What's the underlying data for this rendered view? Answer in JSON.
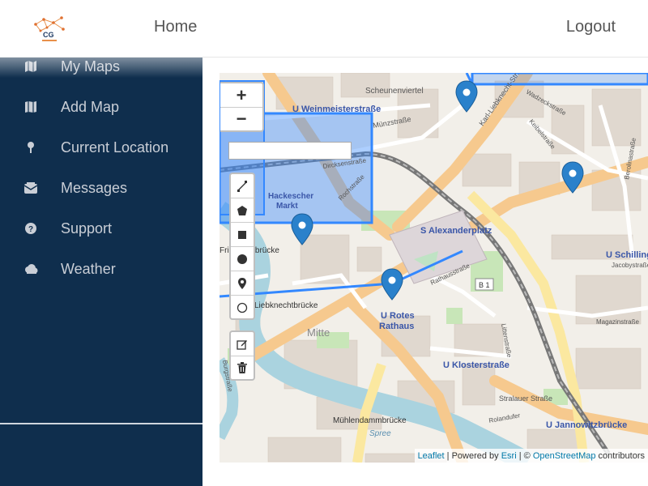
{
  "header": {
    "logo_text": "CG",
    "home_label": "Home",
    "logout_label": "Logout"
  },
  "sidebar": {
    "items": [
      {
        "label": "My Maps",
        "icon": "map-icon"
      },
      {
        "label": "Add Map",
        "icon": "map-fold-icon"
      },
      {
        "label": "Current Location",
        "icon": "pin-icon"
      },
      {
        "label": "Messages",
        "icon": "envelope-icon"
      },
      {
        "label": "Support",
        "icon": "question-circle-icon"
      },
      {
        "label": "Weather",
        "icon": "cloud-icon"
      }
    ]
  },
  "map": {
    "zoom_in": "+",
    "zoom_out": "−",
    "search_value": "",
    "draw_tools": [
      "polyline-icon",
      "polygon-icon",
      "rectangle-icon",
      "circle-icon",
      "marker-icon",
      "circle-marker-icon"
    ],
    "edit_tools": [
      "edit-icon",
      "trash-icon"
    ],
    "labels": {
      "weinmeister": "U Weinmeisterstraße",
      "scheunenviertel": "Scheunenviertel",
      "muenzstrasse": "Münzstraße",
      "karl_liebknecht": "Karl-Liebknecht-Str.",
      "hackescher_1": "Hackescher",
      "hackescher_2": "Markt",
      "alexanderplatz": "S Alexanderplatz",
      "rathausstrasse": "Rathausstraße",
      "b1": "B 1",
      "rotes_1": "U Rotes",
      "rotes_2": "Rathaus",
      "mitte": "Mitte",
      "klosterstrasse": "U Klosterstraße",
      "liebknechtbruecke": "Liebknechtbrücke",
      "friedrichsbruecke": "Friedrichsbrücke",
      "muehlendamm": "Mühlendammbrücke",
      "stralauer": "Stralauer Straße",
      "jannowitz": "U Jannowitzbrücke",
      "schilling": "U Schilling",
      "jacobystrasse": "Jacobystraße",
      "magazinstrasse": "Magazinstraße",
      "berolinastrasse": "Berolinastraße",
      "keibelstrasse": "Keibelstraße",
      "wadzeckstrasse": "Wadzeckstraße",
      "rochstrasse": "Rochstraße",
      "dircksenstrasse": "Dircksenstraße",
      "littenstrasse": "Littenstraße",
      "rolandufer": "Rolandufer",
      "spree": "Spree",
      "burgstrasse": "Burgstraße"
    },
    "attribution": {
      "leaflet": "Leaflet",
      "powered": " | Powered by ",
      "esri": "Esri",
      "sep": " | © ",
      "osm": "OpenStreetMap",
      "contrib": " contributors"
    }
  },
  "colors": {
    "sidebar_bg": "#0f2e4d",
    "sidebar_text": "#c9ced6",
    "accent_blue": "#3388ff",
    "marker_blue": "#2a81cb"
  }
}
